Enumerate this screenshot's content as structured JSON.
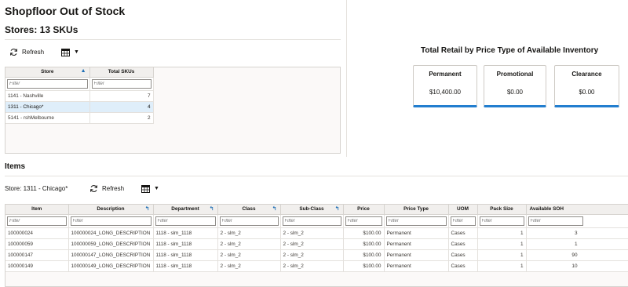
{
  "page": {
    "title": "Shopfloor Out of Stock"
  },
  "stores": {
    "title": "Stores: 13 SKUs",
    "refresh_label": "Refresh",
    "columns": [
      "Store",
      "Total SKUs"
    ],
    "filter_placeholder": "Filter",
    "rows": [
      {
        "store": "1141 - Nashville",
        "skus": "7"
      },
      {
        "store": "1311 - Chicago*",
        "skus": "4"
      },
      {
        "store": "5141 - rshMelbourne",
        "skus": "2"
      }
    ]
  },
  "summary": {
    "title": "Total Retail by Price Type of Available Inventory",
    "cards": [
      {
        "label": "Permanent",
        "value": "$10,400.00"
      },
      {
        "label": "Promotional",
        "value": "$0.00"
      },
      {
        "label": "Clearance",
        "value": "$0.00"
      }
    ]
  },
  "items": {
    "title": "Items",
    "store_label": "Store: 1311 - Chicago*",
    "refresh_label": "Refresh",
    "filter_placeholder": "Filter",
    "columns": [
      "Item",
      "Description",
      "Department",
      "Class",
      "Sub-Class",
      "Price",
      "Price Type",
      "UOM",
      "Pack Size",
      "Available SOH"
    ],
    "rows": [
      {
        "item": "100000024",
        "description": "100000024_LONG_DESCRIPTION",
        "department": "1118 - slm_1118",
        "class": "2 - slm_2",
        "subclass": "2 - slm_2",
        "price": "$100.00",
        "price_type": "Permanent",
        "uom": "Cases",
        "pack_size": "1",
        "soh": "3"
      },
      {
        "item": "100000059",
        "description": "100000059_LONG_DESCRIPTION",
        "department": "1118 - slm_1118",
        "class": "2 - slm_2",
        "subclass": "2 - slm_2",
        "price": "$100.00",
        "price_type": "Permanent",
        "uom": "Cases",
        "pack_size": "1",
        "soh": "1"
      },
      {
        "item": "100000147",
        "description": "100000147_LONG_DESCRIPTION",
        "department": "1118 - slm_1118",
        "class": "2 - slm_2",
        "subclass": "2 - slm_2",
        "price": "$100.00",
        "price_type": "Permanent",
        "uom": "Cases",
        "pack_size": "1",
        "soh": "90"
      },
      {
        "item": "100000149",
        "description": "100000149_LONG_DESCRIPTION",
        "department": "1118 - slm_1118",
        "class": "2 - slm_2",
        "subclass": "2 - slm_2",
        "price": "$100.00",
        "price_type": "Permanent",
        "uom": "Cases",
        "pack_size": "1",
        "soh": "10"
      }
    ]
  },
  "colors": {
    "accent": "#227ecf",
    "selected_row": "#dfeefa",
    "link": "#1f5fa3"
  },
  "icons": {
    "refresh": "refresh-icon",
    "view": "grid-view-icon",
    "sort": "sort-asc-icon"
  }
}
